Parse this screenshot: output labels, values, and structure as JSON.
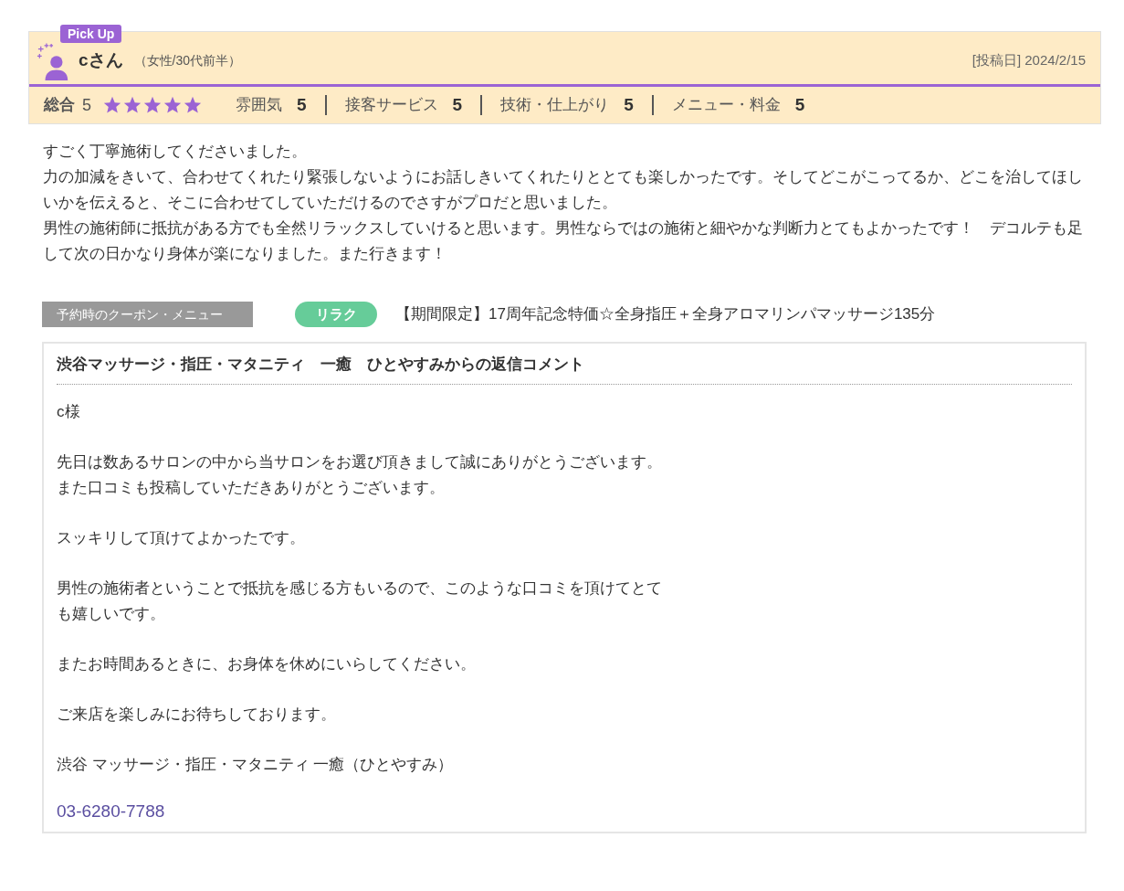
{
  "review": {
    "badge": "Pick Up",
    "reviewer": "cさん",
    "reviewer_info": "（女性/30代前半）",
    "posted_date": "[投稿日] 2024/2/15",
    "overall_label": "総合",
    "overall_score": "5",
    "stars": 5,
    "ratings": [
      {
        "label": "雰囲気",
        "score": "5"
      },
      {
        "label": "接客サービス",
        "score": "5"
      },
      {
        "label": "技術・仕上がり",
        "score": "5"
      },
      {
        "label": "メニュー・料金",
        "score": "5"
      }
    ],
    "body": [
      "すごく丁寧施術してくださいました。",
      "力の加減をきいて、合わせてくれたり緊張しないようにお話しきいてくれたりととても楽しかったです。そしてどこがこってるか、どこを治してほしいかを伝えると、そこに合わせてしていただけるのでさすがプロだと思いました。",
      "男性の施術師に抵抗がある方でも全然リラックスしていけると思います。男性ならではの施術と細やかな判断力とてもよかったです！　デコルテも足して次の日かなり身体が楽になりました。また行きます！"
    ],
    "coupon_label": "予約時のクーポン・メニュー",
    "coupon_tag": "リラク",
    "coupon_text": "【期間限定】17周年記念特価☆全身指圧＋全身アロマリンパマッサージ135分"
  },
  "reply": {
    "title": "渋谷マッサージ・指圧・マタニティ　一癒　ひとやすみからの返信コメント",
    "paragraphs": [
      [
        "c様"
      ],
      [
        "先日は数あるサロンの中から当サロンをお選び頂きまして誠にありがとうございます。",
        "また口コミも投稿していただきありがとうございます。"
      ],
      [
        "スッキリして頂けてよかったです。"
      ],
      [
        "男性の施術者ということで抵抗を感じる方もいるので、このような口コミを頂けてとて",
        "も嬉しいです。"
      ],
      [
        "またお時間あるときに、お身体を休めにいらしてください。"
      ],
      [
        "ご来店を楽しみにお待ちしております。"
      ],
      [
        "渋谷 マッサージ・指圧・マタニティ 一癒（ひとやすみ）"
      ]
    ],
    "phone": "03-6280-7788"
  }
}
